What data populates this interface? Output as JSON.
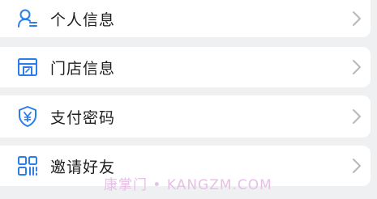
{
  "menu": {
    "items": [
      {
        "label": "个人信息",
        "icon": "user-info-icon"
      },
      {
        "label": "门店信息",
        "icon": "store-icon"
      },
      {
        "label": "支付密码",
        "icon": "shield-yen-icon"
      },
      {
        "label": "邀请好友",
        "icon": "qr-code-icon"
      }
    ],
    "chevron_icon": "chevron-right-icon"
  },
  "watermark": {
    "text": "康掌门 • KANGZM.COM"
  },
  "colors": {
    "icon_blue": "#2b7de9",
    "chevron_gray": "#b8b8b8",
    "background": "#eef0f2",
    "card": "#ffffff",
    "watermark": "#e4c2e4"
  }
}
